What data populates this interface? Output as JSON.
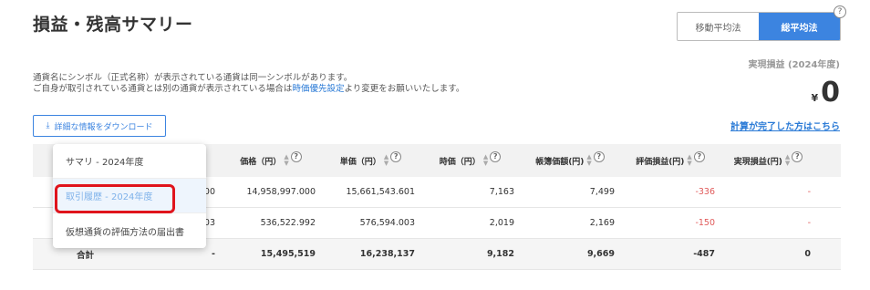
{
  "page_title": "損益・残高サマリー",
  "help_glyph": "?",
  "method_toggle": {
    "moving_avg": "移動平均法",
    "total_avg": "総平均法"
  },
  "notice": {
    "line1": "通貨名にシンボル（正式名称）が表示されている通貨は同一シンボルがあります。",
    "line2_prefix": "ご自身が取引されている通貨とは別の通貨が表示されている場合は",
    "line2_link": "時価優先設定",
    "line2_suffix": "より変更をお願いいたします。"
  },
  "realized": {
    "label": "実現損益 (2024年度)",
    "currency": "¥",
    "value": "0"
  },
  "download_button": {
    "icon": "⤓",
    "label": "詳細な情報をダウンロード"
  },
  "calc_done_link": "計算が完了した方はこちら",
  "dropdown": {
    "items": [
      "サマリ - 2024年度",
      "取引履歴 - 2024年度",
      "仮想通貨の評価方法の届出書"
    ]
  },
  "table": {
    "headers": [
      "価格（円）",
      "単価（円）",
      "時価（円）",
      "帳簿価額(円)",
      "評価損益(円)",
      "実現損益(円)"
    ],
    "rows": [
      {
        "qty": "000",
        "price": "14,958,997.000",
        "unit": "15,661,543.601",
        "market": "7,163",
        "book": "7,499",
        "eval": "-336",
        "realized": "-"
      },
      {
        "qty": "003",
        "price": "536,522.992",
        "unit": "576,594.003",
        "market": "2,019",
        "book": "2,169",
        "eval": "-150",
        "realized": "-"
      }
    ],
    "total": {
      "label": "合計",
      "qty": "-",
      "price": "15,495,519",
      "unit": "16,238,137",
      "market": "9,182",
      "book": "9,669",
      "eval": "-487",
      "realized": "0"
    }
  }
}
